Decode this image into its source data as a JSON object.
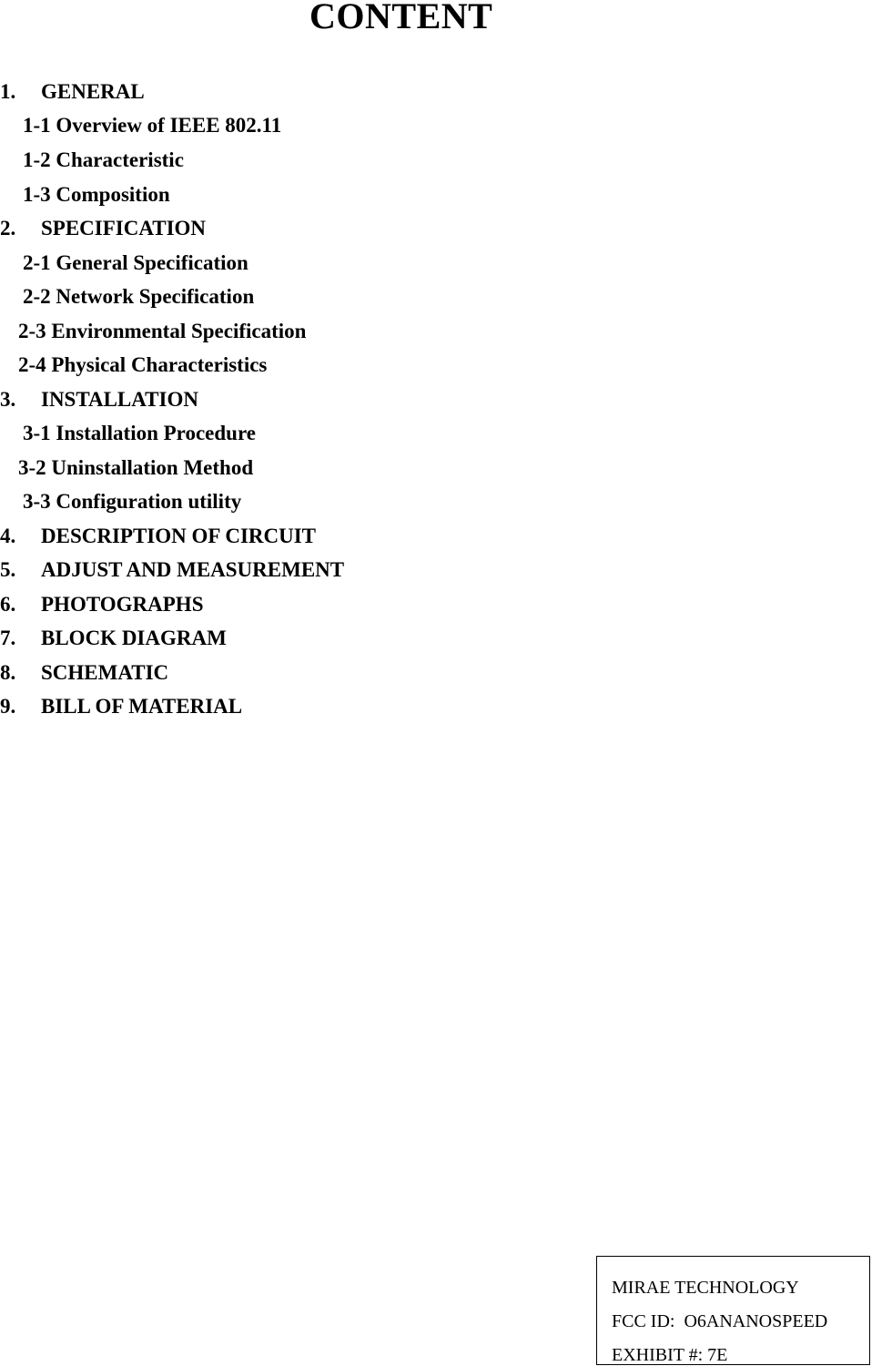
{
  "document": {
    "title": "CONTENT",
    "toc": [
      {
        "level": 1,
        "number": "1.",
        "label": "GENERAL"
      },
      {
        "level": 2,
        "label": "1-1 Overview of IEEE 802.11"
      },
      {
        "level": 2,
        "label": "1-2 Characteristic"
      },
      {
        "level": 2,
        "label": "1-3 Composition"
      },
      {
        "level": 1,
        "number": "2.",
        "label": "SPECIFICATION"
      },
      {
        "level": 2,
        "label": "2-1 General Specification"
      },
      {
        "level": 2,
        "label": "2-2 Network Specification"
      },
      {
        "level": 2,
        "label": "2-3 Environmental Specification"
      },
      {
        "level": 2,
        "label": "2-4 Physical Characteristics"
      },
      {
        "level": 1,
        "number": "3.",
        "label": "INSTALLATION"
      },
      {
        "level": 2,
        "label": "3-1 Installation Procedure"
      },
      {
        "level": 2,
        "label": "3-2 Uninstallation Method"
      },
      {
        "level": 2,
        "label": "3-3 Configuration utility"
      },
      {
        "level": 1,
        "number": "4.",
        "label": "DESCRIPTION OF CIRCUIT"
      },
      {
        "level": 1,
        "number": "5.",
        "label": "ADJUST AND MEASUREMENT"
      },
      {
        "level": 1,
        "number": "6.",
        "label": "PHOTOGRAPHS"
      },
      {
        "level": 1,
        "number": "7.",
        "label": "BLOCK DIAGRAM"
      },
      {
        "level": 1,
        "number": "8.",
        "label": "SCHEMATIC"
      },
      {
        "level": 1,
        "number": "9.",
        "label": "BILL OF MATERIAL"
      }
    ],
    "footer_box": {
      "company": "MIRAE TECHNOLOGY",
      "fcc_id": "FCC ID:  O6ANANOSPEED",
      "exhibit": "EXHIBIT #: 7E"
    }
  }
}
